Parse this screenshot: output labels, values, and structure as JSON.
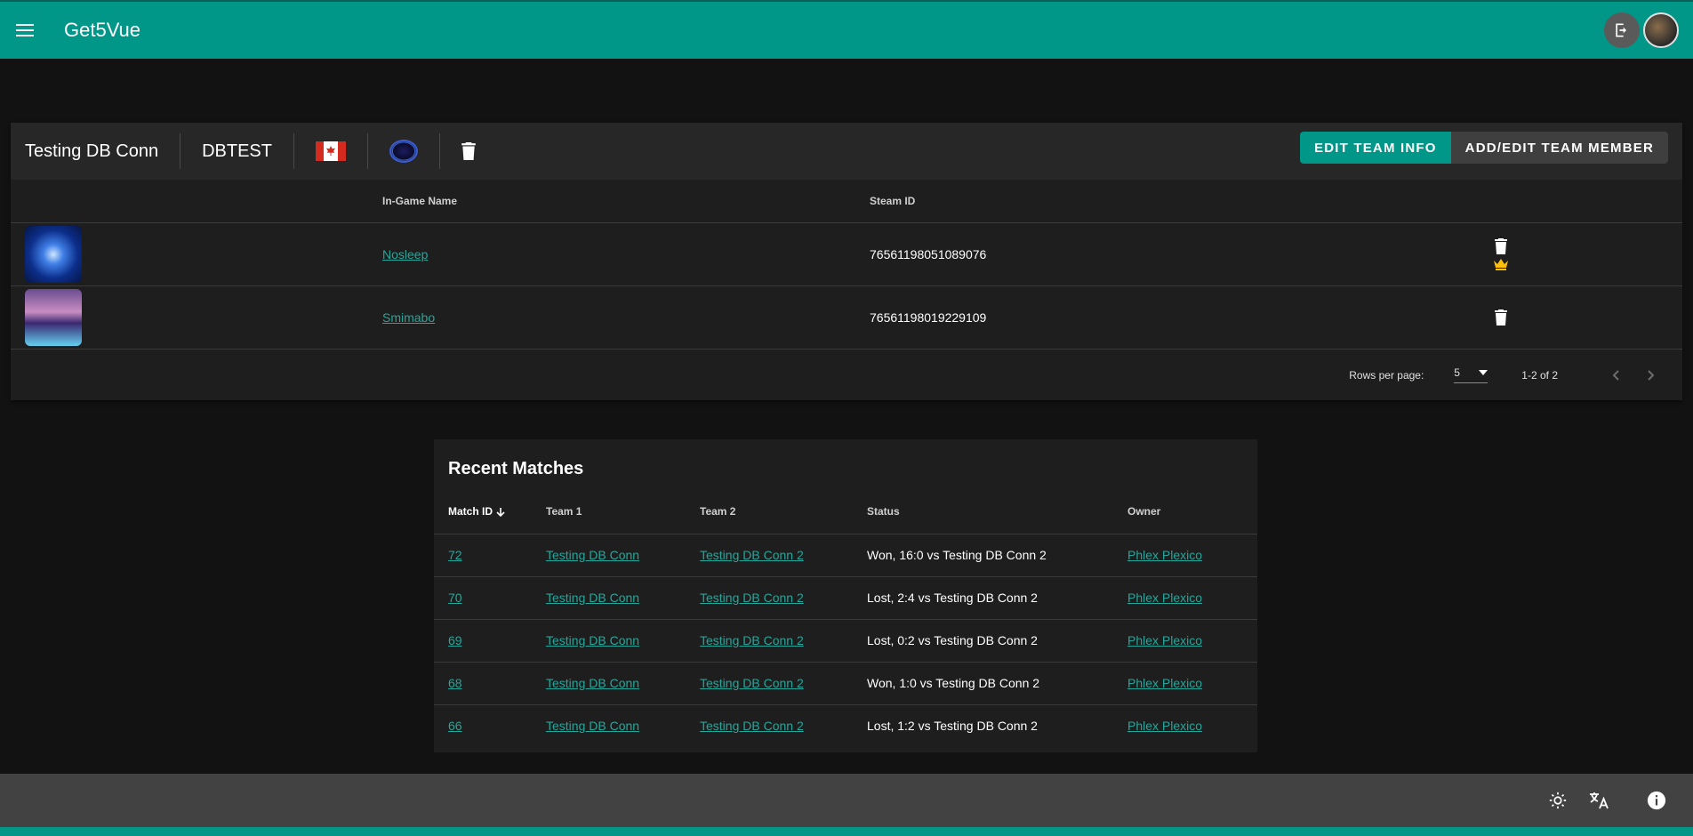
{
  "app": {
    "title": "Get5Vue",
    "accent": "#009688"
  },
  "team": {
    "name": "Testing DB Conn",
    "tag": "DBTEST",
    "flag": "Canada",
    "buttons": {
      "edit_info": "Edit Team Info",
      "add_member": "Add/Edit Team Member"
    },
    "columns": [
      "",
      "In-Game Name",
      "Steam ID",
      ""
    ],
    "members": [
      {
        "name": "Nosleep",
        "steam_id": "76561198051089076",
        "is_leader": true
      },
      {
        "name": "Smimabo",
        "steam_id": "76561198019229109",
        "is_leader": false
      }
    ],
    "pager": {
      "rows_per_page_label": "Rows per page:",
      "rows_per_page": "5",
      "range": "1-2 of 2"
    }
  },
  "matches": {
    "title": "Recent Matches",
    "columns": [
      "Match ID",
      "Team 1",
      "Team 2",
      "Status",
      "Owner"
    ],
    "rows": [
      {
        "id": "72",
        "team1": "Testing DB Conn",
        "team2": "Testing DB Conn 2",
        "status": "Won, 16:0 vs Testing DB Conn 2",
        "owner": "Phlex Plexico"
      },
      {
        "id": "70",
        "team1": "Testing DB Conn",
        "team2": "Testing DB Conn 2",
        "status": "Lost, 2:4 vs Testing DB Conn 2",
        "owner": "Phlex Plexico"
      },
      {
        "id": "69",
        "team1": "Testing DB Conn",
        "team2": "Testing DB Conn 2",
        "status": "Lost, 0:2 vs Testing DB Conn 2",
        "owner": "Phlex Plexico"
      },
      {
        "id": "68",
        "team1": "Testing DB Conn",
        "team2": "Testing DB Conn 2",
        "status": "Won, 1:0 vs Testing DB Conn 2",
        "owner": "Phlex Plexico"
      },
      {
        "id": "66",
        "team1": "Testing DB Conn",
        "team2": "Testing DB Conn 2",
        "status": "Lost, 1:2 vs Testing DB Conn 2",
        "owner": "Phlex Plexico"
      }
    ]
  }
}
